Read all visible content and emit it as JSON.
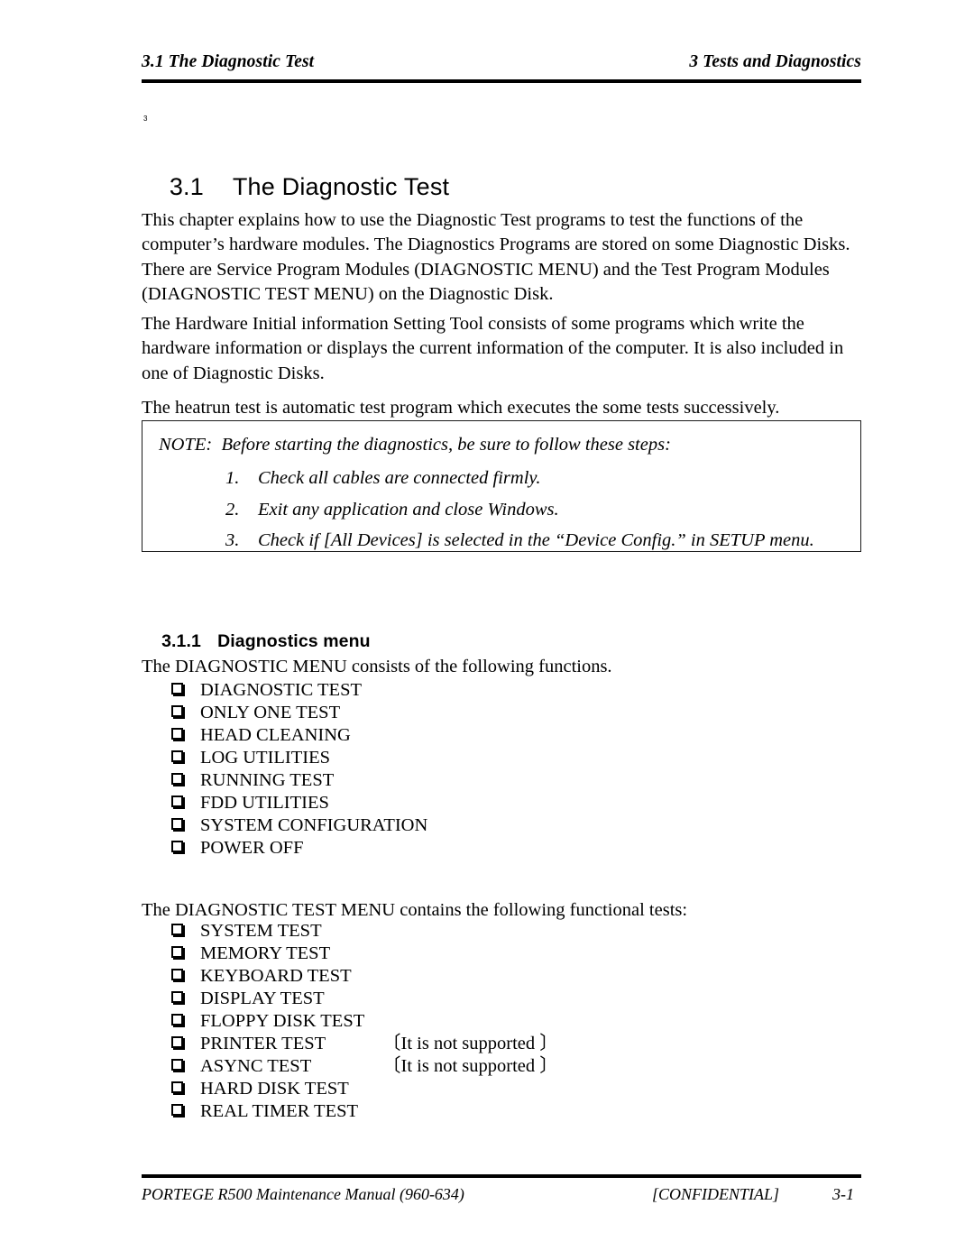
{
  "header": {
    "left": "3.1 The Diagnostic Test",
    "right": "3  Tests and Diagnostics"
  },
  "title": {
    "superscript": "3",
    "number": "3.1",
    "text": "The Diagnostic Test"
  },
  "paragraphs": {
    "p1": "This chapter explains how to use the Diagnostic Test programs to test the functions of the computer’s hardware modules. The Diagnostics Programs are stored on some Diagnostic Disks. There are Service Program Modules (DIAGNOSTIC MENU) and the Test Program Modules (DIAGNOSTIC TEST MENU) on the Diagnostic Disk.",
    "p2": "The Hardware Initial information Setting Tool consists of some programs which write the hardware information or displays the current information of the computer. It is also included in one of Diagnostic Disks.",
    "p3": "The heatrun test is automatic test program which executes the some tests successively."
  },
  "note": {
    "label": "NOTE:",
    "intro": "Before starting the diagnostics, be sure to follow these steps:",
    "steps": [
      {
        "number": "1.",
        "text": "Check all cables are connected firmly."
      },
      {
        "number": "2.",
        "text": "Exit any application and close Windows."
      },
      {
        "number": "3.",
        "text": "Check if [All Devices] is selected in the “Device Config.” in SETUP menu."
      }
    ]
  },
  "subsection": {
    "number": "3.1.1",
    "title": "Diagnostics menu",
    "intro_menu": "The DIAGNOSTIC MENU consists of the following functions.",
    "intro_test_menu": "The DIAGNOSTIC TEST MENU contains the following functional tests:"
  },
  "diagnostic_menu_items": [
    {
      "label": "DIAGNOSTIC TEST",
      "note": ""
    },
    {
      "label": "ONLY ONE TEST",
      "note": ""
    },
    {
      "label": "HEAD CLEANING",
      "note": ""
    },
    {
      "label": "LOG UTILITIES",
      "note": ""
    },
    {
      "label": "RUNNING TEST",
      "note": ""
    },
    {
      "label": "FDD UTILITIES",
      "note": ""
    },
    {
      "label": "SYSTEM CONFIGURATION",
      "note": ""
    },
    {
      "label": "POWER OFF",
      "note": ""
    }
  ],
  "diagnostic_test_menu_items": [
    {
      "label": "SYSTEM TEST",
      "note": ""
    },
    {
      "label": "MEMORY TEST",
      "note": ""
    },
    {
      "label": "KEYBOARD TEST",
      "note": ""
    },
    {
      "label": "DISPLAY TEST",
      "note": ""
    },
    {
      "label": "FLOPPY DISK TEST",
      "note": ""
    },
    {
      "label": "PRINTER TEST",
      "note": "〔It is not supported 〕"
    },
    {
      "label": "ASYNC TEST",
      "note": "〔It is not supported 〕"
    },
    {
      "label": "HARD DISK TEST",
      "note": ""
    },
    {
      "label": "REAL TIMER TEST",
      "note": ""
    }
  ],
  "footer": {
    "left": "PORTEGE R500 Maintenance Manual (960-634)",
    "center": "[CONFIDENTIAL]",
    "right": "3-1"
  },
  "colors": {
    "text": "#000000",
    "background": "#ffffff",
    "rule": "#000000",
    "note_border": "#1a1a1a"
  }
}
